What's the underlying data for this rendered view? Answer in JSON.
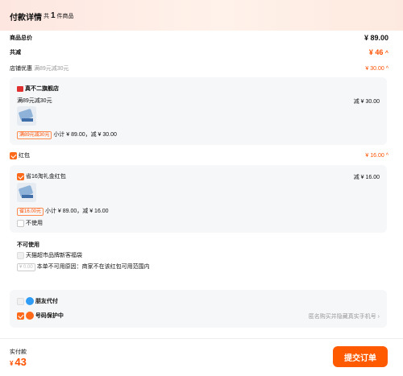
{
  "header": {
    "title": "付款详情",
    "count_prefix": "共",
    "count_num": "1",
    "count_suffix": "件商品"
  },
  "summary": {
    "total_label": "商品总价",
    "total_value": "¥ 89.00",
    "discount_label": "共减",
    "discount_value": "¥ 46",
    "shop_promo_label": "店铺优惠",
    "shop_promo_note": "满89元减30元",
    "shop_promo_value": "¥ 30.00"
  },
  "shop": {
    "name": "真不二旗舰店",
    "promo": "满89元减30元",
    "reduce": "减 ¥ 30.00",
    "tag": "满89元减30元",
    "subtotal": "小计 ¥ 89.00，减 ¥ 30.00"
  },
  "hongbao": {
    "label": "红包",
    "value": "¥ 16.00",
    "item_label": "省16淘礼金红包",
    "item_reduce": "减 ¥ 16.00",
    "tag": "省16.00元",
    "subtotal": "小计 ¥ 89.00，减 ¥ 16.00",
    "not_use": "不使用"
  },
  "unusable": {
    "title": "不可使用",
    "item1": "天猫超市品牌新客福袋",
    "tag": "¥ 0.00",
    "item2": "本单不可用原因：商家不在该红包可用范围内"
  },
  "options": {
    "friend_pay": "朋友代付",
    "privacy": "号码保护中",
    "privacy_note": "匿名购买并隐藏真实手机号"
  },
  "footer": {
    "pay_label": "实付款",
    "currency": "¥",
    "amount": "43",
    "submit": "提交订单"
  },
  "colors": {
    "accent": "#ff5000",
    "button": "#ff5a00",
    "card": "#f6f7f9",
    "header_gradient": "#fde6e0"
  }
}
